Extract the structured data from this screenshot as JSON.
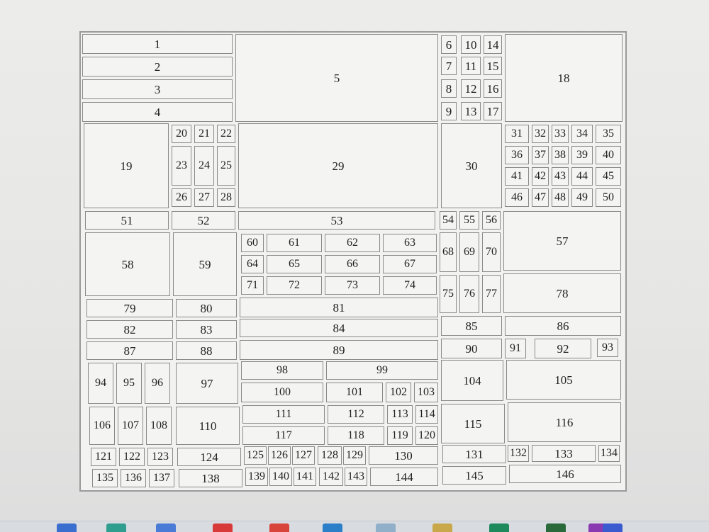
{
  "cells": {
    "c1": "1",
    "c2": "2",
    "c3": "3",
    "c4": "4",
    "c5": "5",
    "c6": "6",
    "c7": "7",
    "c8": "8",
    "c9": "9",
    "c10": "10",
    "c11": "11",
    "c12": "12",
    "c13": "13",
    "c14": "14",
    "c15": "15",
    "c16": "16",
    "c17": "17",
    "c18": "18",
    "c19": "19",
    "c20": "20",
    "c21": "21",
    "c22": "22",
    "c23": "23",
    "c24": "24",
    "c25": "25",
    "c26": "26",
    "c27": "27",
    "c28": "28",
    "c29": "29",
    "c30": "30",
    "c31": "31",
    "c32": "32",
    "c33": "33",
    "c34": "34",
    "c35": "35",
    "c36": "36",
    "c37": "37",
    "c38": "38",
    "c39": "39",
    "c40": "40",
    "c41": "41",
    "c42": "42",
    "c43": "43",
    "c44": "44",
    "c45": "45",
    "c46": "46",
    "c47": "47",
    "c48": "48",
    "c49": "49",
    "c50": "50",
    "c51": "51",
    "c52": "52",
    "c53": "53",
    "c54": "54",
    "c55": "55",
    "c56": "56",
    "c57": "57",
    "c58": "58",
    "c59": "59",
    "c60": "60",
    "c61": "61",
    "c62": "62",
    "c63": "63",
    "c64": "64",
    "c65": "65",
    "c66": "66",
    "c67": "67",
    "c68": "68",
    "c69": "69",
    "c70": "70",
    "c71": "71",
    "c72": "72",
    "c73": "73",
    "c74": "74",
    "c75": "75",
    "c76": "76",
    "c77": "77",
    "c78": "78",
    "c79": "79",
    "c80": "80",
    "c81": "81",
    "c82": "82",
    "c83": "83",
    "c84": "84",
    "c85": "85",
    "c86": "86",
    "c87": "87",
    "c88": "88",
    "c89": "89",
    "c90": "90",
    "c91": "91",
    "c92": "92",
    "c93": "93",
    "c94": "94",
    "c95": "95",
    "c96": "96",
    "c97": "97",
    "c98": "98",
    "c99": "99",
    "c100": "100",
    "c101": "101",
    "c102": "102",
    "c103": "103",
    "c104": "104",
    "c105": "105",
    "c106": "106",
    "c107": "107",
    "c108": "108",
    "c110": "110",
    "c111": "111",
    "c112": "112",
    "c113": "113",
    "c114": "114",
    "c115": "115",
    "c116": "116",
    "c117": "117",
    "c118": "118",
    "c119": "119",
    "c120": "120",
    "c121": "121",
    "c122": "122",
    "c123": "123",
    "c124": "124",
    "c125": "125",
    "c126": "126",
    "c127": "127",
    "c128": "128",
    "c129": "129",
    "c130": "130",
    "c131": "131",
    "c132": "132",
    "c133": "133",
    "c134": "134",
    "c135": "135",
    "c136": "136",
    "c137": "137",
    "c138": "138",
    "c139": "139",
    "c140": "140",
    "c141": "141",
    "c142": "142",
    "c143": "143",
    "c144": "144",
    "c145": "145",
    "c146": "146"
  },
  "taskbar": {
    "icons": [
      "app-icon-1",
      "app-icon-2",
      "app-icon-3",
      "app-icon-4",
      "app-icon-5",
      "app-icon-6",
      "app-icon-7",
      "app-icon-8",
      "app-icon-9",
      "app-icon-10",
      "app-icon-11",
      "app-icon-12"
    ],
    "colors": [
      "#3a6fd0",
      "#2f9e8f",
      "#4a7bd6",
      "#d83a3a",
      "#d8443a",
      "#2a7fc8",
      "#8fb0c8",
      "#c8a84a",
      "#1e8a5c",
      "#2a6a3a",
      "#8a3ab0",
      "#3a5ad0"
    ]
  }
}
